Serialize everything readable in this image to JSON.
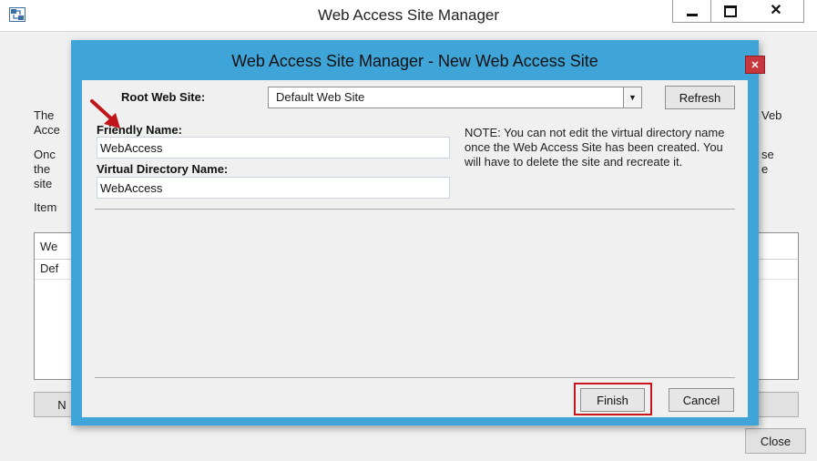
{
  "parent_window": {
    "title": "Web Access Site Manager",
    "left_text_fragments": [
      "The",
      "Acce",
      "Onc",
      "the",
      "site",
      "Item"
    ],
    "right_text_fragments": [
      "Veb",
      "se",
      "e"
    ],
    "list_header_fragment": "We",
    "list_row_fragment": "Def",
    "new_button_fragment": "N",
    "close_button_label": "Close"
  },
  "dialog": {
    "title": "Web Access Site Manager - New Web Access Site",
    "root_web_site_label": "Root Web Site:",
    "root_web_site_value": "Default Web Site",
    "refresh_label": "Refresh",
    "friendly_name_label": "Friendly Name:",
    "friendly_name_value": "WebAccess",
    "virtual_directory_label": "Virtual Directory Name:",
    "virtual_directory_value": "WebAccess",
    "note": "NOTE: You can not edit the virtual directory name once the Web Access Site has been created. You will have to delete the site and recreate it.",
    "finish_label": "Finish",
    "cancel_label": "Cancel"
  },
  "colors": {
    "dialog_frame": "#3fa4d8",
    "dialog_close": "#c7373d",
    "highlight": "#c8161d",
    "arrow": "#c0131a"
  },
  "icons": {
    "app_icon": "app-window-icon",
    "minimize": "minimize-icon",
    "maximize": "maximize-icon",
    "close": "close-icon",
    "dropdown": "chevron-down-icon",
    "annotation": "red-arrow-icon"
  }
}
